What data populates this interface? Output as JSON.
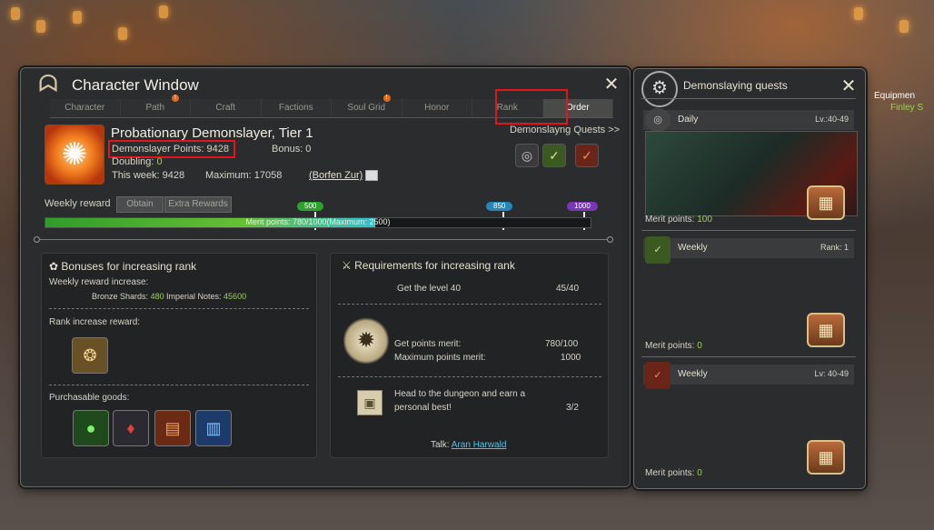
{
  "character_window": {
    "title": "Character Window",
    "logo_icon": "wolf-emblem-icon",
    "tabs": [
      {
        "label": "Character",
        "alert": false,
        "active": false
      },
      {
        "label": "Path",
        "alert": true,
        "active": false
      },
      {
        "label": "Craft",
        "alert": false,
        "active": false
      },
      {
        "label": "Factions",
        "alert": false,
        "active": false
      },
      {
        "label": "Soul Grid",
        "alert": true,
        "active": false
      },
      {
        "label": "Honor",
        "alert": false,
        "active": false
      },
      {
        "label": "Rank",
        "alert": false,
        "active": false
      },
      {
        "label": "Order",
        "alert": false,
        "active": true
      }
    ],
    "alert_mark": "!",
    "rank_title": "Probationary Demonslayer, Tier 1",
    "points_label": "Demonslayer Points: 9428",
    "bonus_label": "Bonus: 0",
    "doubling_label": "Doubling: ",
    "doubling_value": "0",
    "this_week_label": "This week: 9428",
    "maximum_label": "Maximum: 17058",
    "npc_link": "(Borfen Zur)",
    "quests_link": "Demonslayng Quests >>",
    "weekly_reward_label": "Weekly reward",
    "obtain_button": "Obtain",
    "extra_rewards_button": "Extra Rewards",
    "milestones": [
      "500",
      "850",
      "1000"
    ],
    "progress_text": "Merit points: 780/1000(Maximum: 2500)",
    "progress_value": 780,
    "progress_max": 1000
  },
  "bonuses": {
    "title": "Bonuses for increasing rank",
    "weekly_increase_label": "Weekly reward increase:",
    "bronze_label": "Bronze Shards:",
    "bronze_value": "480",
    "notes_label": "Imperial Notes:",
    "notes_value": "45600",
    "rank_reward_label": "Rank increase reward:",
    "purchasable_label": "Purchasable goods:"
  },
  "requirements": {
    "title": "Requirements for increasing rank",
    "level_label": "Get the level 40",
    "level_value": "45/40",
    "merit_label": "Get points merit:",
    "merit_value": "780/100",
    "max_merit_label": "Maximum points merit:",
    "max_merit_value": "1000",
    "dungeon_label_1": "Head to the dungeon and earn a",
    "dungeon_label_2": "personal best!",
    "dungeon_value": "3/2",
    "talk_label": "Talk:",
    "talk_link": "Aran Harwald"
  },
  "side": {
    "title": "Demonslaying quests",
    "quests": [
      {
        "label": "Daily",
        "level": "Lv.:40-49",
        "merit_label": "Merit points:",
        "merit_value": "100"
      },
      {
        "label": "Weekly",
        "level": "Rank: 1",
        "merit_label": "Merit points:",
        "merit_value": "0"
      },
      {
        "label": "Weekly",
        "level": "Lv: 40-49",
        "merit_label": "Merit points:",
        "merit_value": "0"
      }
    ]
  },
  "background": {
    "equipment_label": "Equipmen",
    "npc_name": "Finley S"
  }
}
